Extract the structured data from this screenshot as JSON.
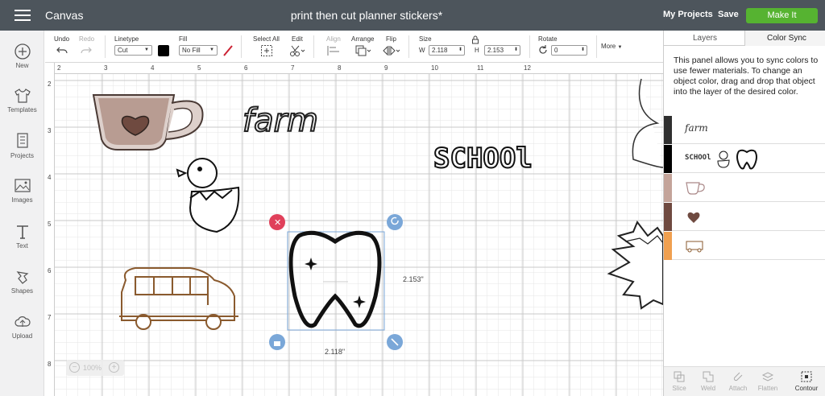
{
  "topbar": {
    "app_title": "Canvas",
    "doc_title": "print then cut planner stickers*",
    "my_projects": "My Projects",
    "save": "Save",
    "make_it": "Make It"
  },
  "leftrail": {
    "items": [
      {
        "label": "New",
        "icon": "plus-circle-icon"
      },
      {
        "label": "Templates",
        "icon": "tshirt-icon"
      },
      {
        "label": "Projects",
        "icon": "projects-icon"
      },
      {
        "label": "Images",
        "icon": "image-icon"
      },
      {
        "label": "Text",
        "icon": "text-icon"
      },
      {
        "label": "Shapes",
        "icon": "shapes-icon"
      },
      {
        "label": "Upload",
        "icon": "upload-icon"
      }
    ]
  },
  "toolbar": {
    "undo": "Undo",
    "redo": "Redo",
    "linetype_label": "Linetype",
    "linetype_value": "Cut",
    "fill_label": "Fill",
    "fill_value": "No Fill",
    "select_all": "Select All",
    "edit": "Edit",
    "align": "Align",
    "arrange": "Arrange",
    "flip": "Flip",
    "size_label": "Size",
    "w_label": "W",
    "w_value": "2.118",
    "h_label": "H",
    "h_value": "2.153",
    "rotate_label": "Rotate",
    "rotate_value": "0",
    "more": "More",
    "linetype_color": "#000000",
    "fill_color": "#cc2233"
  },
  "canvas": {
    "ruler_top": [
      "2",
      "3",
      "4",
      "5",
      "6",
      "7",
      "8",
      "9",
      "10",
      "11",
      "12"
    ],
    "ruler_left": [
      "2",
      "3",
      "4",
      "5",
      "6",
      "7",
      "8"
    ],
    "width_dim": "2.118\"",
    "height_dim": "2.153\"",
    "zoom": "100%",
    "text_farm": "farm",
    "text_school": "SCHOOl",
    "colors": {
      "mug_fill": "#b89c92",
      "heart": "#6f4a40",
      "bus": "#8a5a2e",
      "selection": "#7aa7d8",
      "delete_handle": "#e0405a"
    }
  },
  "rightpanel": {
    "tab_layers": "Layers",
    "tab_color_sync": "Color Sync",
    "description": "This panel allows you to sync colors to use fewer materials. To change an object color, drag and drop that object into the layer of the desired color.",
    "swatches": [
      {
        "color": "#2f2f2f",
        "items": [
          "farm"
        ]
      },
      {
        "color": "#000000",
        "items": [
          "SCHOOl",
          "chick",
          "tooth"
        ]
      },
      {
        "color": "#c4a49a",
        "items": [
          "mug"
        ]
      },
      {
        "color": "#6f4a40",
        "items": [
          "heart"
        ]
      },
      {
        "color": "#f0a050",
        "items": [
          "bus"
        ]
      }
    ],
    "farm_thumb": "farm",
    "school_thumb": "SCHOOl",
    "footer": [
      "Slice",
      "Weld",
      "Attach",
      "Flatten",
      "Contour"
    ]
  }
}
